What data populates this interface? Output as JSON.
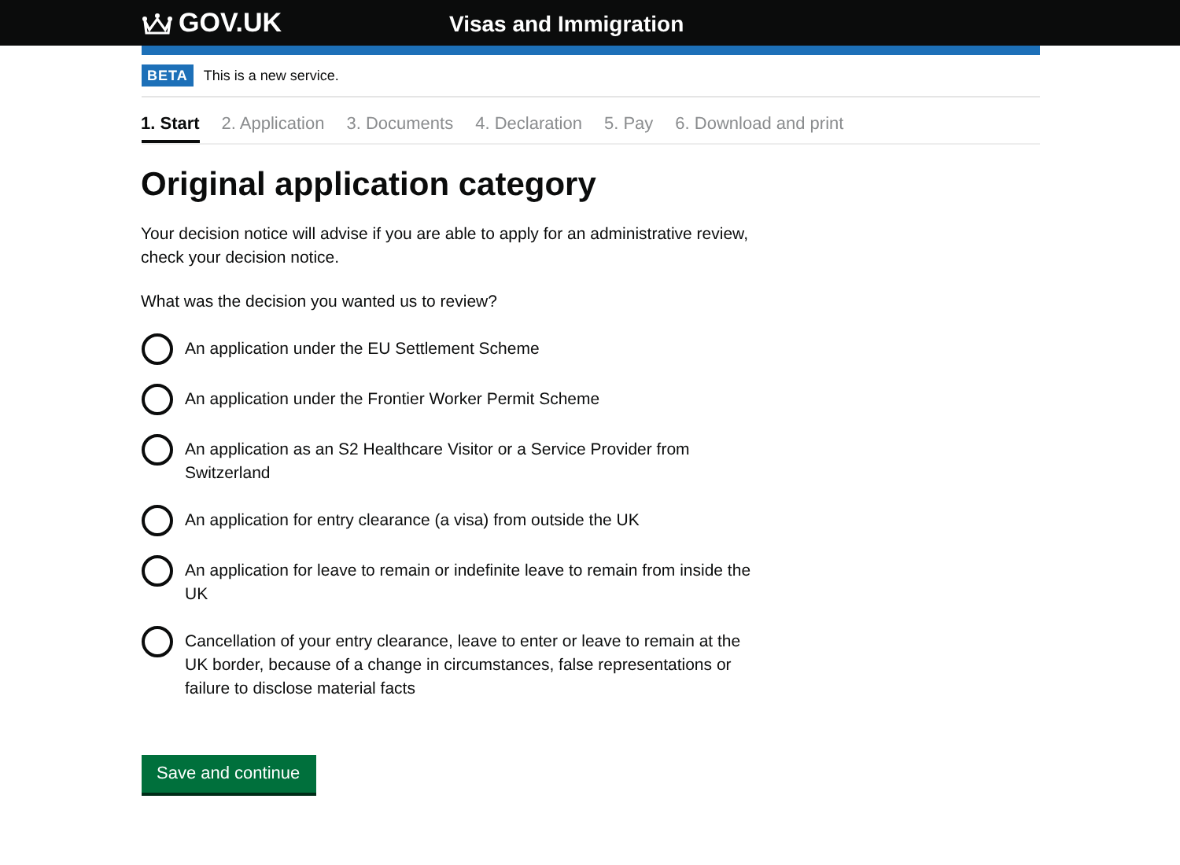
{
  "header": {
    "logo": "GOV.UK",
    "service": "Visas and Immigration"
  },
  "phase_banner": {
    "tag": "BETA",
    "text": "This is a new service."
  },
  "steps": [
    {
      "label": "1. Start",
      "selected": true
    },
    {
      "label": "2. Application",
      "selected": false
    },
    {
      "label": "3. Documents",
      "selected": false
    },
    {
      "label": "4. Declaration",
      "selected": false
    },
    {
      "label": "5. Pay",
      "selected": false
    },
    {
      "label": "6. Download and print",
      "selected": false
    }
  ],
  "heading": "Original application category",
  "intro": "Your decision notice will advise if you are able to apply for an administrative review, check your decision notice.",
  "question": "What was the decision you wanted us to review?",
  "options": [
    {
      "label": "An application under the EU Settlement Scheme",
      "selected": false
    },
    {
      "label": "An application under the Frontier Worker Permit Scheme",
      "selected": false
    },
    {
      "label": "An application as an S2 Healthcare Visitor or a Service Provider from Switzerland",
      "selected": false
    },
    {
      "label": "An application for entry clearance (a visa) from outside the UK",
      "selected": false
    },
    {
      "label": "An application for leave to remain or indefinite leave to remain from inside the UK",
      "selected": false
    },
    {
      "label": "Cancellation of your entry clearance, leave to enter or leave to remain at the UK border, because of a change in circumstances, false representations or failure to disclose material facts",
      "selected": false
    }
  ],
  "button": "Save and continue"
}
